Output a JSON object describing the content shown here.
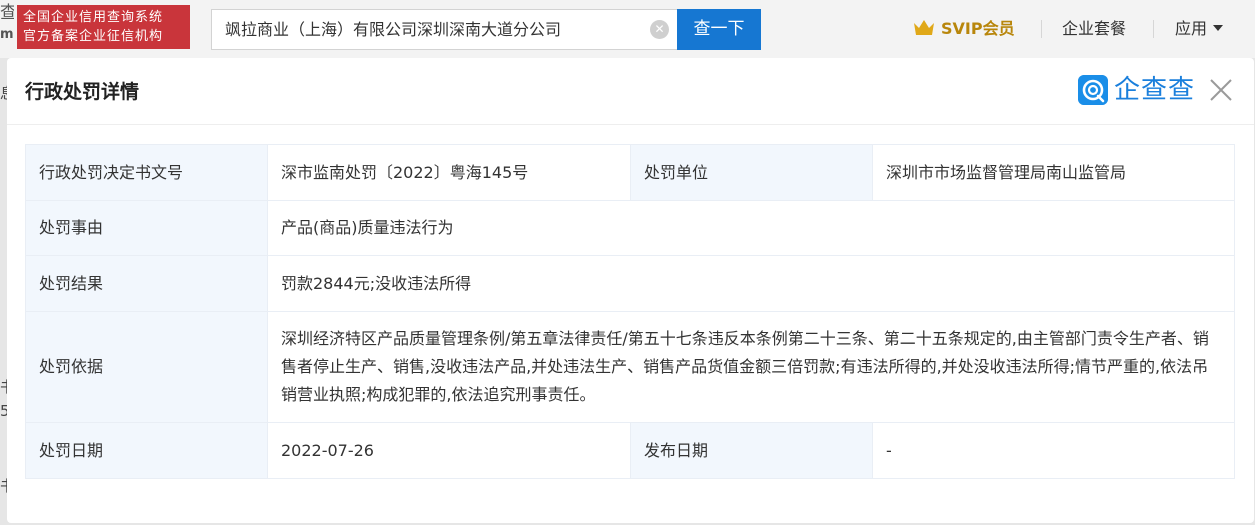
{
  "header": {
    "logo_fragment": "查",
    "logo_fragment_2": "m",
    "cert_badge": [
      "全国企业信用查询系统",
      "官方备案企业征信机构"
    ],
    "search": {
      "value": "飒拉商业（上海）有限公司深圳深南大道分公司",
      "button_label": "查一下"
    },
    "svip_label": "SVIP会员",
    "nav": {
      "enterprise_package": "企业套餐",
      "apps": "应用"
    },
    "left_fragments": [
      "息",
      "书",
      "5",
      "书"
    ]
  },
  "modal": {
    "title": "行政处罚详情",
    "brand": "企查查",
    "rows": {
      "decision_no_label": "行政处罚决定书文号",
      "decision_no_value": "深市监南处罚〔2022〕粤海145号",
      "unit_label": "处罚单位",
      "unit_value": "深圳市市场监督管理局南山监管局",
      "reason_label": "处罚事由",
      "reason_value": "产品(商品)质量违法行为",
      "result_label": "处罚结果",
      "result_value": "罚款2844元;没收违法所得",
      "basis_label": "处罚依据",
      "basis_value": "深圳经济特区产品质量管理条例/第五章法律责任/第五十七条违反本条例第二十三条、第二十五条规定的,由主管部门责令生产者、销售者停止生产、销售,没收违法产品,并处违法生产、销售产品货值金额三倍罚款;有违法所得的,并处没收违法所得;情节严重的,依法吊销营业执照;构成犯罪的,依法追究刑事责任。",
      "date_label": "处罚日期",
      "date_value": "2022-07-26",
      "publish_label": "发布日期",
      "publish_value": "-"
    }
  },
  "colors": {
    "primary": "#1677d2",
    "badge_red": "#c9353b",
    "svip_gold": "#b8860b",
    "label_bg": "#f2f7fd"
  },
  "icons": {
    "clear": "clear-icon",
    "crown": "crown-icon",
    "brand": "qcc-logo-icon",
    "close": "close-icon",
    "caret": "chevron-down-icon"
  }
}
